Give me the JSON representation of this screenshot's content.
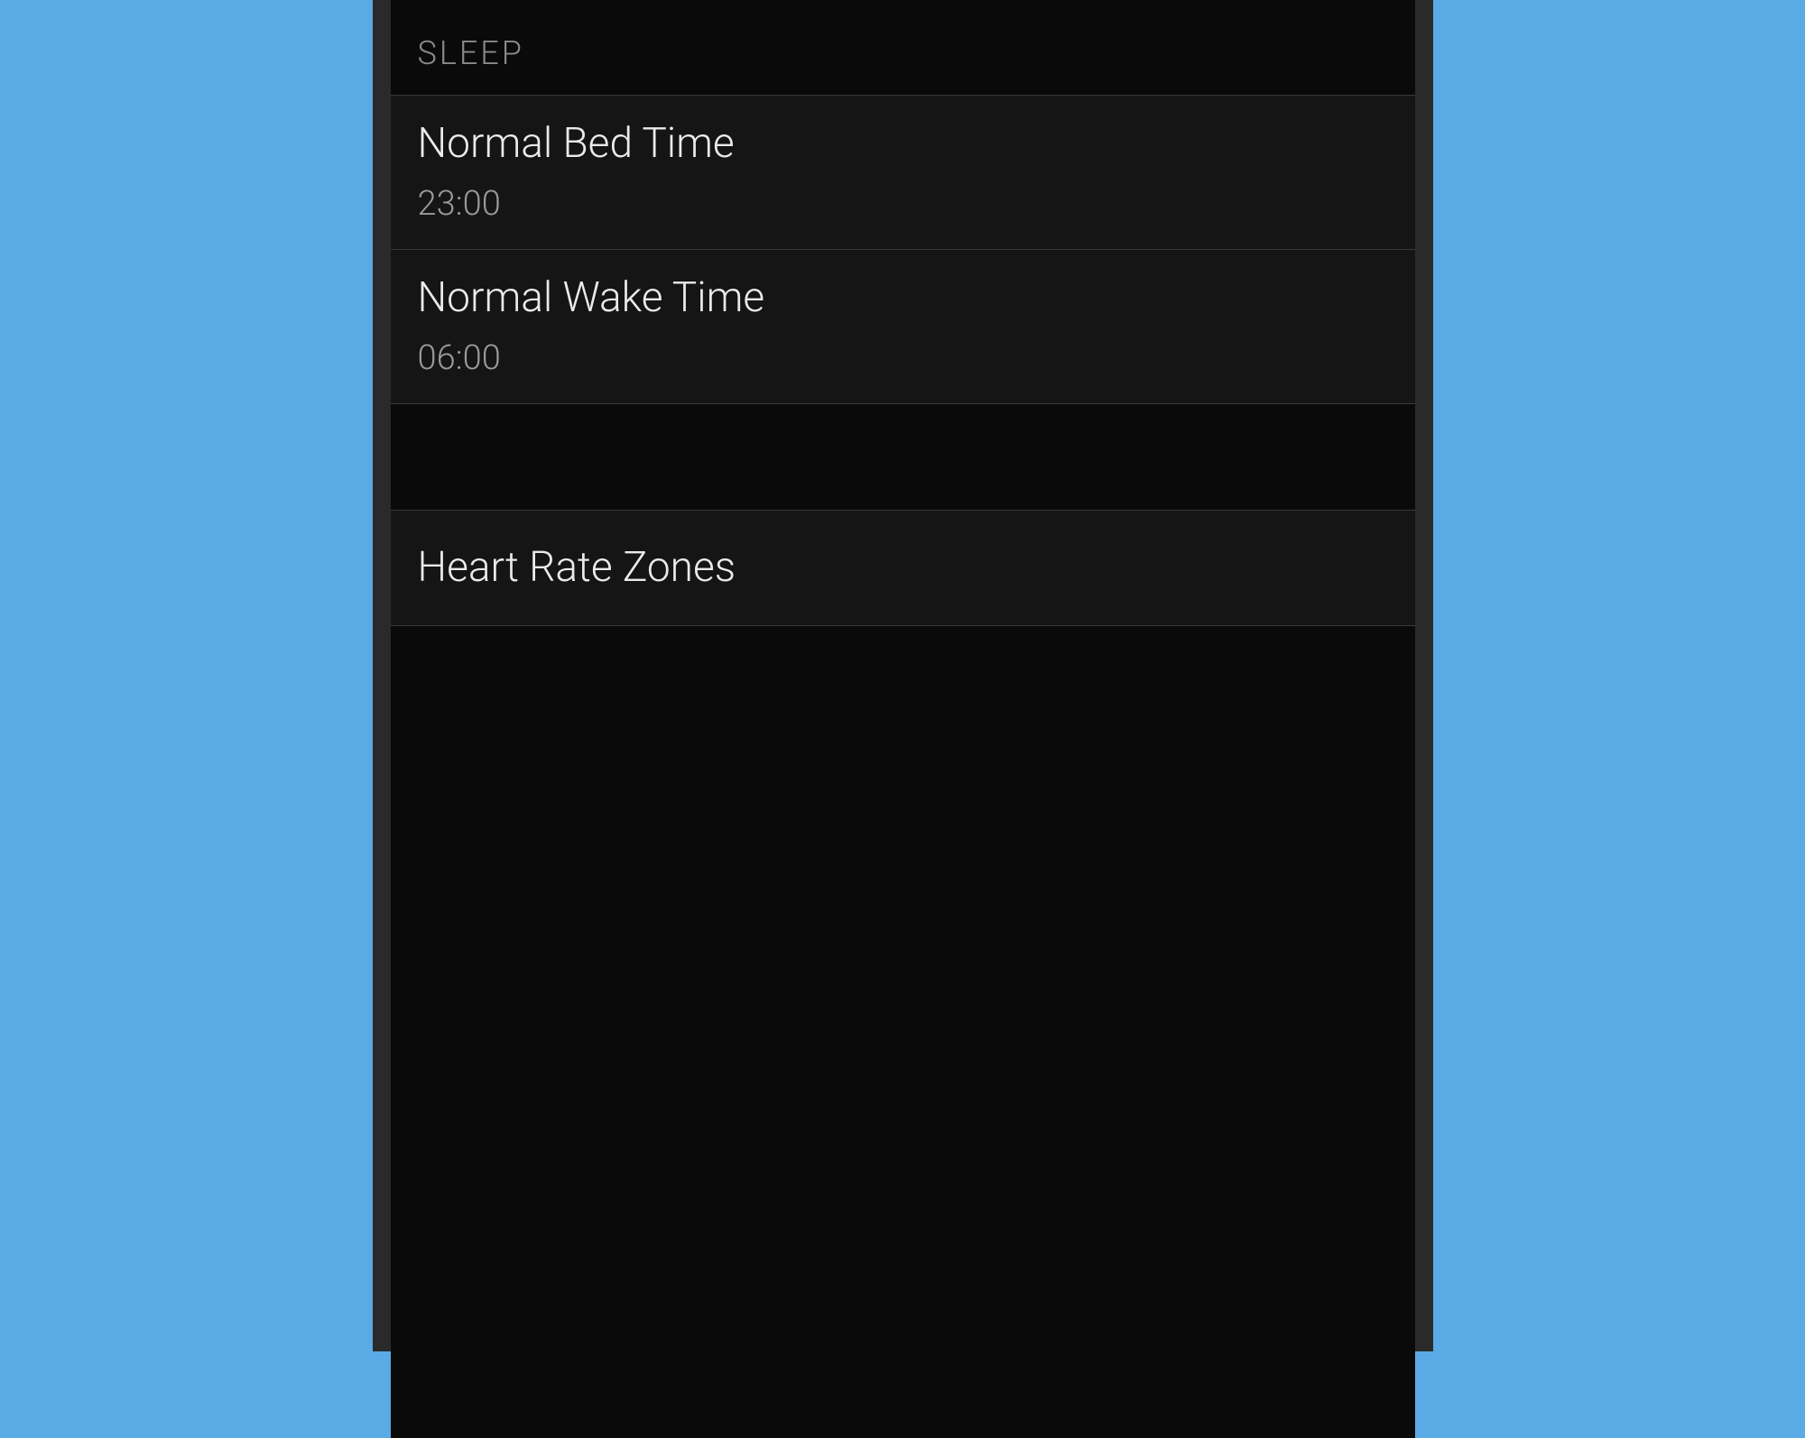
{
  "colors": {
    "background": "#5aaae6",
    "frame": "#2a2a2a",
    "screen": "#0a0a0a",
    "row": "#151515",
    "divider": "#3a3a3a",
    "textPrimary": "#eaeaea",
    "textSecondary": "#9a9a9a",
    "headerText": "#8a8a8a"
  },
  "sleep": {
    "header": "SLEEP",
    "bedTime": {
      "label": "Normal Bed Time",
      "value": "23:00"
    },
    "wakeTime": {
      "label": "Normal Wake Time",
      "value": "06:00"
    }
  },
  "heartRate": {
    "zonesLabel": "Heart Rate Zones"
  }
}
